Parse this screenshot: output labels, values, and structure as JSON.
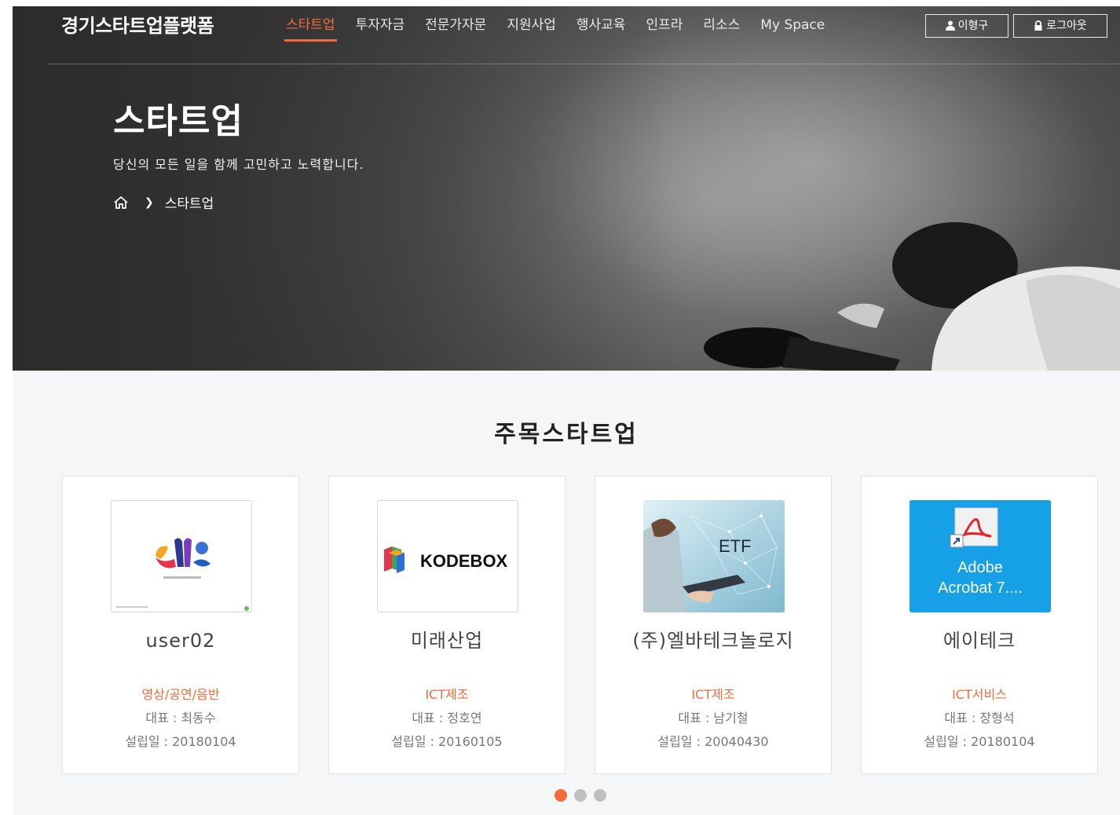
{
  "nav": {
    "logo": "경기스타트업플랫폼",
    "menu": [
      "스타트업",
      "투자자금",
      "전문가자문",
      "지원사업",
      "행사교육",
      "인프라",
      "리소스",
      "My Space"
    ],
    "active_index": 0,
    "user_button": "이형구",
    "logout_button": "로그아웃"
  },
  "hero": {
    "title": "스타트업",
    "subtitle": "당신의 모든 일을 함께 고민하고 노력합니다.",
    "breadcrumb": "스타트업"
  },
  "section": {
    "title": "주목스타트업"
  },
  "cards": [
    {
      "name": "user02",
      "category": "영상/공연/음반",
      "ceo": "대표 : 최동수",
      "founded": "설립일 : 20180104",
      "thumb": "abstract-logo"
    },
    {
      "name": "미래산업",
      "category": "ICT제조",
      "ceo": "대표 : 정호연",
      "founded": "설립일 : 20160105",
      "thumb": "kodebox-logo",
      "thumb_text": "KODEBOX"
    },
    {
      "name": "(주)엘바테크놀로지",
      "category": "ICT제조",
      "ceo": "대표 : 남기철",
      "founded": "설립일 : 20040430",
      "thumb": "etf-photo",
      "thumb_text": "ETF"
    },
    {
      "name": "에이테크",
      "category": "ICT서비스",
      "ceo": "대표 : 장형석",
      "founded": "설립일 : 20180104",
      "thumb": "adobe-acrobat-icon",
      "thumb_text_1": "Adobe",
      "thumb_text_2": "Acrobat 7...."
    }
  ],
  "pagination": {
    "count": 3,
    "active": 0
  },
  "colors": {
    "accent": "#f26b3a",
    "card_bg": "#ffffff",
    "page_bg": "#f5f6f7"
  }
}
